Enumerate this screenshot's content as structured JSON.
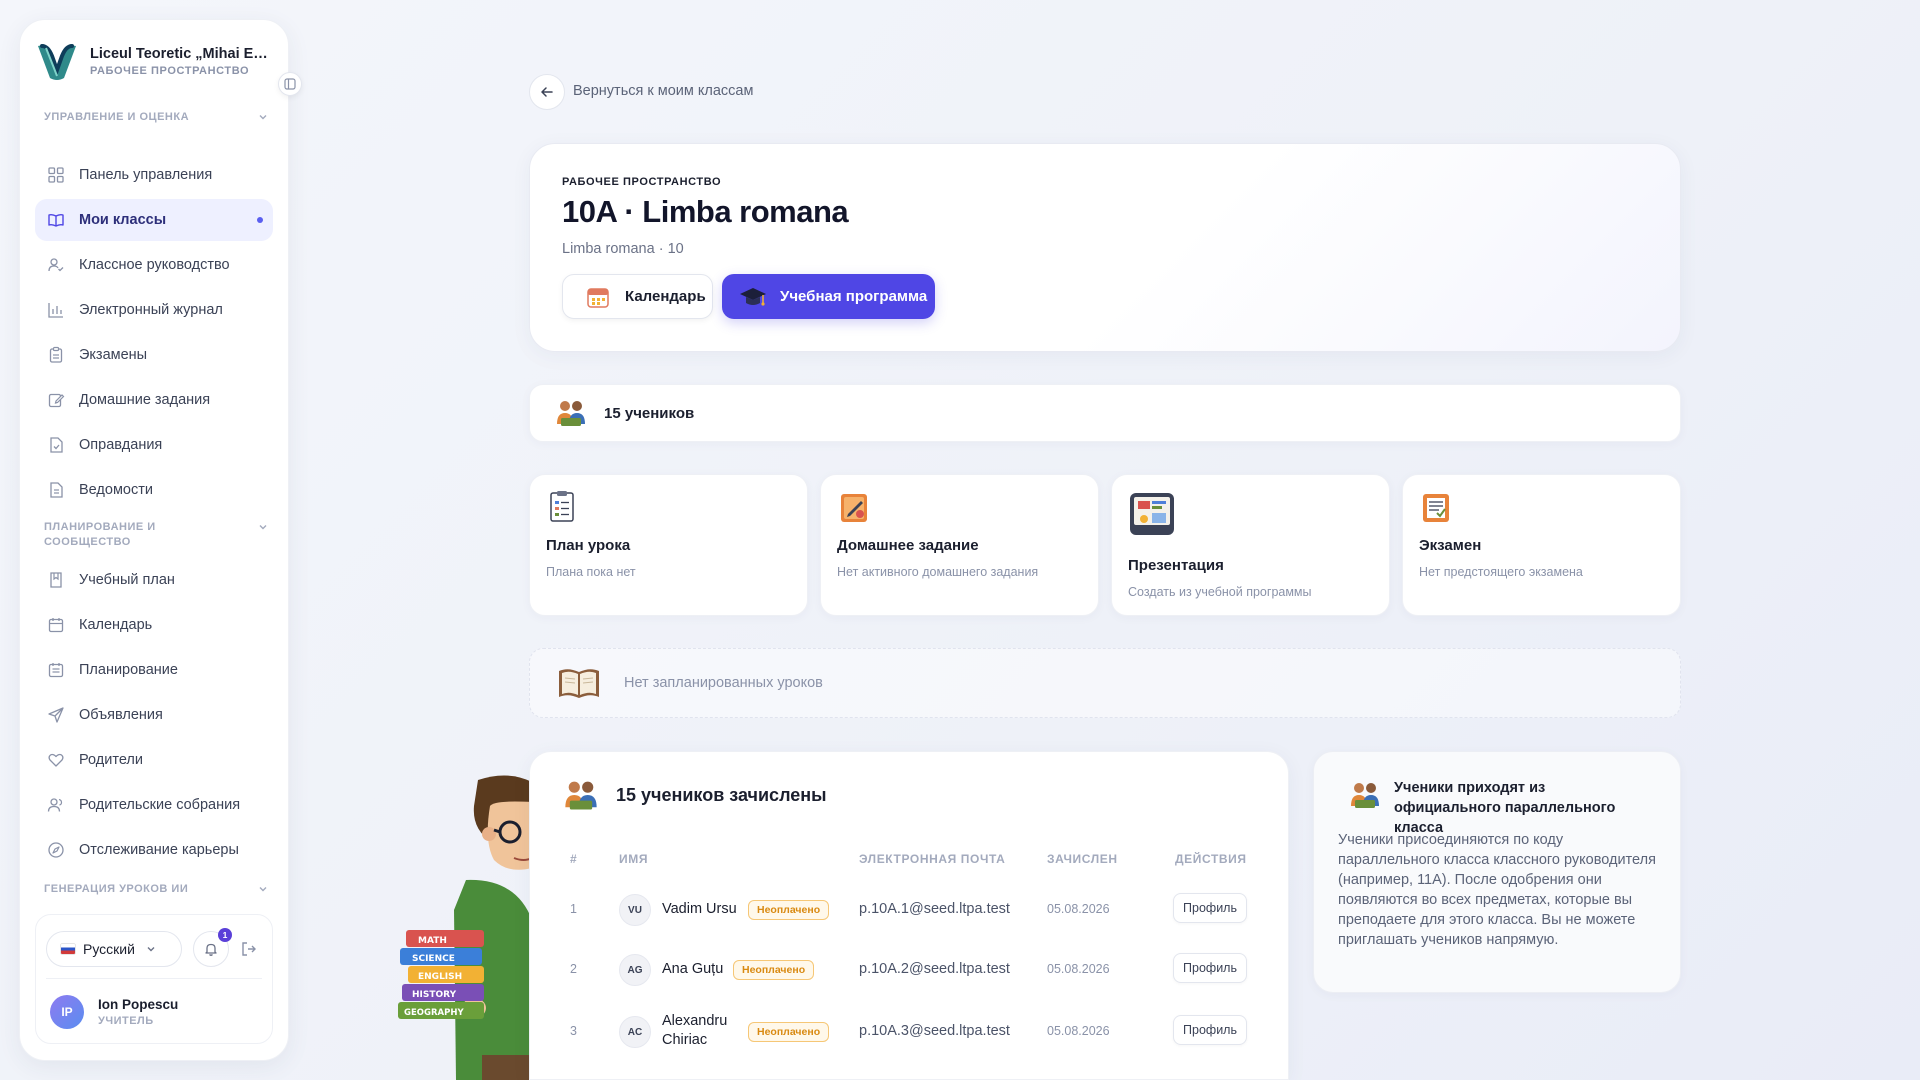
{
  "brand": {
    "name": "Liceul Teoretic „Mihai Eminescu”",
    "subtitle": "РАБОЧЕЕ ПРОСТРАНСТВО"
  },
  "sidebar": {
    "sections": [
      {
        "title": "УПРАВЛЕНИЕ И ОЦЕНКА"
      },
      {
        "title": "ПЛАНИРОВАНИЕ И СООБЩЕСТВО"
      },
      {
        "title": "ГЕНЕРАЦИЯ УРОКОВ ИИ"
      }
    ],
    "items": [
      {
        "label": "Панель управления",
        "icon": "dashboard-icon"
      },
      {
        "label": "Мои классы",
        "icon": "book-open-icon",
        "active": true
      },
      {
        "label": "Классное руководство",
        "icon": "user-check-icon"
      },
      {
        "label": "Электронный журнал",
        "icon": "bar-chart-icon"
      },
      {
        "label": "Экзамены",
        "icon": "clipboard-icon"
      },
      {
        "label": "Домашние задания",
        "icon": "edit-icon"
      },
      {
        "label": "Оправдания",
        "icon": "file-check-icon"
      },
      {
        "label": "Ведомости",
        "icon": "file-text-icon"
      },
      {
        "label": "Учебный план",
        "icon": "book-icon"
      },
      {
        "label": "Календарь",
        "icon": "calendar-icon"
      },
      {
        "label": "Планирование",
        "icon": "calendar-list-icon"
      },
      {
        "label": "Объявления",
        "icon": "send-icon"
      },
      {
        "label": "Родители",
        "icon": "heart-icon"
      },
      {
        "label": "Родительские собрания",
        "icon": "users-icon"
      },
      {
        "label": "Отслеживание карьеры",
        "icon": "compass-icon"
      }
    ],
    "footer": {
      "language": "Русский",
      "notifications": "1",
      "user_initials": "IP",
      "user_name": "Ion Popescu",
      "user_role": "УЧИТЕЛЬ"
    }
  },
  "nav": {
    "back_label": "Вернуться к моим классам"
  },
  "hero": {
    "eyebrow": "РАБОЧЕЕ ПРОСТРАНСТВО",
    "title": "10A · Limba romana",
    "subtitle": "Limba romana · 10",
    "calendar_label": "Календарь",
    "program_label": "Учебная программа"
  },
  "students_bar": {
    "label": "15 учеников"
  },
  "tiles": [
    {
      "title": "План урока",
      "subtitle": "Плана пока нет",
      "icon": "lesson-plan-icon"
    },
    {
      "title": "Домашнее задание",
      "subtitle": "Нет активного домашнего задания",
      "icon": "homework-icon"
    },
    {
      "title": "Презентация",
      "subtitle": "Создать из учебной программы",
      "icon": "presentation-icon"
    },
    {
      "title": "Экзамен",
      "subtitle": "Нет предстоящего экзамена",
      "icon": "exam-icon"
    }
  ],
  "empty_lessons": {
    "label": "Нет запланированных уроков"
  },
  "enrolled": {
    "title": "15 учеников зачислены",
    "columns": [
      "#",
      "ИМЯ",
      "ЭЛЕКТРОННАЯ ПОЧТА",
      "ЗАЧИСЛЕН",
      "ДЕЙСТВИЯ"
    ],
    "rows": [
      {
        "num": "1",
        "initials": "VU",
        "name": "Vadim Ursu",
        "badge": "Неоплачено",
        "email": "p.10A.1@seed.ltpa.test",
        "date": "05.08.2026",
        "action": "Профиль"
      },
      {
        "num": "2",
        "initials": "AG",
        "name": "Ana Guțu",
        "badge": "Неоплачено",
        "email": "p.10A.2@seed.ltpa.test",
        "date": "05.08.2026",
        "action": "Профиль"
      },
      {
        "num": "3",
        "initials": "AC",
        "name": "Alexandru Chiriac",
        "badge": "Неоплачено",
        "email": "p.10A.3@seed.ltpa.test",
        "date": "05.08.2026",
        "action": "Профиль"
      }
    ]
  },
  "info": {
    "title": "Ученики приходят из официального параллельного класса",
    "body": "Ученики присоединяются по коду параллельного класса классного руководителя (например, 11A). После одобрения они появляются во всех предметах, которые вы преподаете для этого класса. Вы не можете приглашать учеников напрямую."
  },
  "mascot_books": [
    "MATH",
    "SCIENCE",
    "ENGLISH",
    "HISTORY",
    "GEOGRAPHY"
  ],
  "colors": {
    "accent": "#4f46e5",
    "badge": "#d98a12",
    "active_bg": "#eef0ff"
  }
}
